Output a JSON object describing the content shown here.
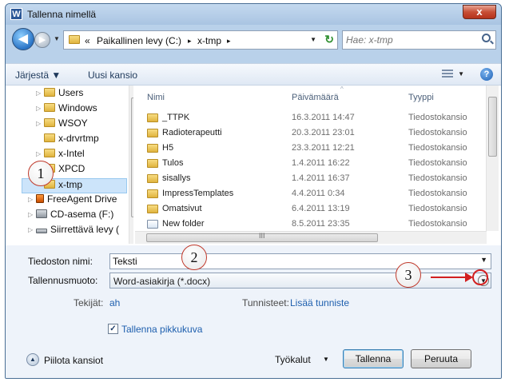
{
  "window": {
    "title": "Tallenna nimellä",
    "close_label": "x"
  },
  "navigation": {
    "breadcrumb": [
      "«",
      "Paikallinen levy (C:)",
      "▸",
      "x-tmp",
      "▸"
    ],
    "search_placeholder": "Hae: x-tmp"
  },
  "toolbar": {
    "organize_label": "Järjestä ▼",
    "new_folder_label": "Uusi kansio"
  },
  "nav_pane": {
    "items": [
      {
        "label": "Users",
        "icon": "folder-icon",
        "expandable": true
      },
      {
        "label": "Windows",
        "icon": "folder-icon",
        "expandable": true
      },
      {
        "label": "WSOY",
        "icon": "folder-icon",
        "expandable": true
      },
      {
        "label": "x-drvrtmp",
        "icon": "folder-icon",
        "expandable": false
      },
      {
        "label": "x-Intel",
        "icon": "folder-icon",
        "expandable": true
      },
      {
        "label": "XPCD",
        "icon": "folder-icon",
        "expandable": false
      },
      {
        "label": "x-tmp",
        "icon": "folder-icon",
        "expandable": false,
        "selected": true
      },
      {
        "label": "FreeAgent Drive",
        "icon": "external-drive-icon",
        "expandable": true
      },
      {
        "label": "CD-asema (F:)",
        "icon": "cd-drive-icon",
        "expandable": true
      },
      {
        "label": "Siirrettävä levy (",
        "icon": "removable-drive-icon",
        "expandable": true
      }
    ]
  },
  "file_list": {
    "columns": [
      "Nimi",
      "Päivämäärä",
      "Tyyppi"
    ],
    "rows": [
      {
        "name": "_TTPK",
        "date": "16.3.2011 14:47",
        "type": "Tiedostokansio",
        "icon": "folder-icon"
      },
      {
        "name": "Radioterapeutti",
        "date": "20.3.2011 23:01",
        "type": "Tiedostokansio",
        "icon": "folder-icon"
      },
      {
        "name": "H5",
        "date": "23.3.2011 12:21",
        "type": "Tiedostokansio",
        "icon": "folder-icon"
      },
      {
        "name": "Tulos",
        "date": "1.4.2011 16:22",
        "type": "Tiedostokansio",
        "icon": "folder-icon"
      },
      {
        "name": "sisallys",
        "date": "1.4.2011 16:37",
        "type": "Tiedostokansio",
        "icon": "folder-icon"
      },
      {
        "name": "ImpressTemplates",
        "date": "4.4.2011 0:34",
        "type": "Tiedostokansio",
        "icon": "folder-icon"
      },
      {
        "name": "Omatsivut",
        "date": "6.4.2011 13:19",
        "type": "Tiedostokansio",
        "icon": "folder-icon"
      },
      {
        "name": "New folder",
        "date": "8.5.2011 23:35",
        "type": "Tiedostokansio",
        "icon": "folder-icon"
      }
    ],
    "hscroll_label": "III"
  },
  "form": {
    "filename_label": "Tiedoston nimi:",
    "filename_value": "Teksti",
    "savetype_label": "Tallennusmuoto:",
    "savetype_value": "Word-asiakirja (*.docx)",
    "authors_label": "Tekijät:",
    "authors_value": "ah",
    "tags_label": "Tunnisteet:",
    "tags_value": "Lisää tunniste",
    "thumbnail_label": "Tallenna pikkukuva",
    "thumbnail_checked": "✓"
  },
  "footer": {
    "hide_folders_label": "Piilota kansiot",
    "tools_label": "Työkalut",
    "tools_arrow": "▼",
    "save_label": "Tallenna",
    "cancel_label": "Peruuta"
  },
  "annotations": [
    "1",
    "2",
    "3"
  ],
  "colors": {
    "annotation_red": "#d21f1f",
    "link_blue": "#1e5fae",
    "selection": "#cce4fa"
  }
}
